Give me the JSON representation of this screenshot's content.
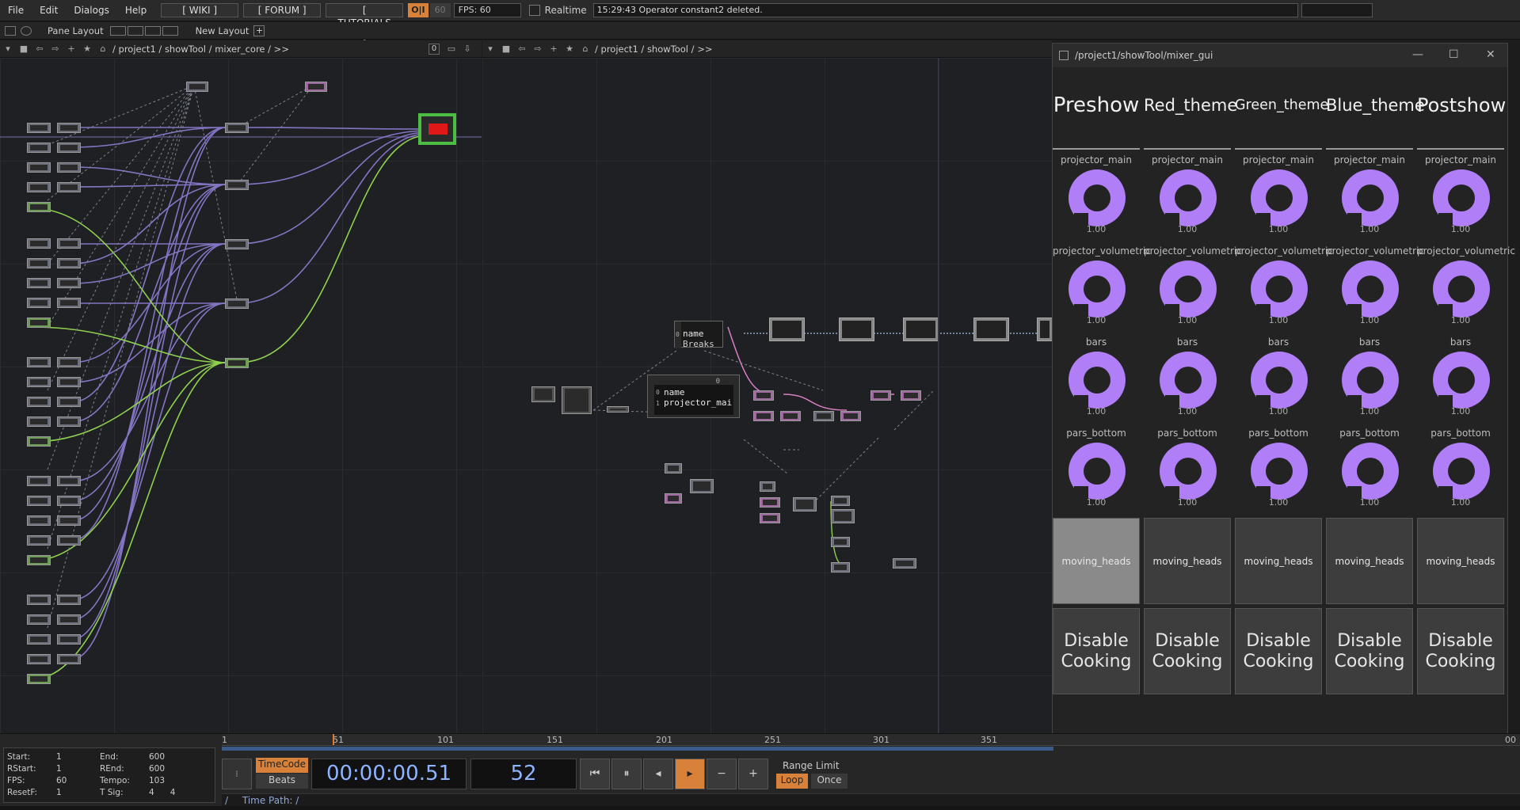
{
  "menu": [
    "File",
    "Edit",
    "Dialogs",
    "Help"
  ],
  "links": [
    "[ WIKI ]",
    "[ FORUM ]",
    "[ TUTORIALS ]"
  ],
  "oi": "O|I",
  "perf": "60",
  "fps": "FPS:  60",
  "realtime": "Realtime",
  "status": "15:29:43 Operator constant2 deleted.",
  "pane_layout": "Pane Layout",
  "new_layout": "New Layout",
  "plus": "+",
  "left_path": "/ project1  /  showTool  /  mixer_core  /  >>",
  "left_zero": "0",
  "mid_path": "/ project1  /  showTool  /  >>",
  "table1": {
    "idx0": "0",
    "c0": "name",
    "c1": "Breaks"
  },
  "table2": {
    "head": "0",
    "idx0": "0",
    "idx1": "1",
    "c0": "name",
    "c1": "projector_mai"
  },
  "window": {
    "title": "/project1/showTool/mixer_gui",
    "columns": [
      "Preshow",
      "Red_theme",
      "Green_theme",
      "Blue_theme",
      "Postshow"
    ],
    "knob_rows": [
      "projector_main",
      "projector_volumetric",
      "bars",
      "pars_bottom"
    ],
    "knob_value": "1.00",
    "button_row": "moving_heads",
    "cook_label": "Disable Cooking"
  },
  "ruler": [
    "1",
    "51",
    "101",
    "151",
    "201",
    "251",
    "301",
    "351",
    "00"
  ],
  "info": {
    "start_k": "Start:",
    "start_v": "1",
    "end_k": "End:",
    "end_v": "600",
    "rstart_k": "RStart:",
    "rstart_v": "1",
    "rend_k": "REnd:",
    "rend_v": "600",
    "fps_k": "FPS:",
    "fps_v": "60",
    "tempo_k": "Tempo:",
    "tempo_v": "103",
    "resetf_k": "ResetF:",
    "resetf_v": "1",
    "tsig_k": "T Sig:",
    "tsig_v": "4      4"
  },
  "timecode": "TimeCode",
  "beats": "Beats",
  "time": "00:00:00.51",
  "frame": "52",
  "range_limit": "Range Limit",
  "loop": "Loop",
  "once": "Once",
  "time_path": "Time Path: /",
  "slash": "/",
  "colors": {
    "knob": "#b07ef7",
    "accent": "#d8813a",
    "purple_wire": "#8f7fd6",
    "green_wire": "#8fd14f"
  }
}
